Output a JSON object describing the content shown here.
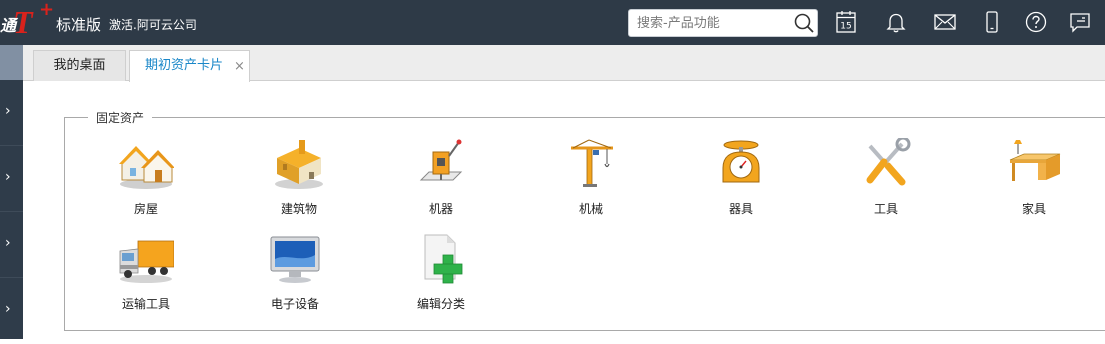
{
  "header": {
    "logo_partial": "通",
    "logo_t": "T",
    "logo_plus": "+",
    "edition": "标准版",
    "activate_text": "激活.阿可云公司",
    "search_placeholder": "搜索-产品功能",
    "calendar_day": "15",
    "icons": [
      "calendar-icon",
      "bell-icon",
      "mail-icon",
      "mobile-icon",
      "help-icon",
      "message-icon"
    ]
  },
  "sidebar": {
    "chevron": "›",
    "items": 4
  },
  "tabs": [
    {
      "label": "我的桌面",
      "active": false
    },
    {
      "label": "期初资产卡片",
      "active": true,
      "close": "×"
    }
  ],
  "group": {
    "legend": "固定资产",
    "assets": [
      {
        "label": "房屋",
        "icon": "houses-icon"
      },
      {
        "label": "建筑物",
        "icon": "building-icon"
      },
      {
        "label": "机器",
        "icon": "machine-icon"
      },
      {
        "label": "机械",
        "icon": "crane-icon"
      },
      {
        "label": "器具",
        "icon": "scale-icon"
      },
      {
        "label": "工具",
        "icon": "tools-icon"
      },
      {
        "label": "家具",
        "icon": "desk-icon"
      },
      {
        "label": "运输工具",
        "icon": "truck-icon"
      },
      {
        "label": "电子设备",
        "icon": "monitor-icon"
      },
      {
        "label": "编辑分类",
        "icon": "add-category-icon"
      }
    ]
  },
  "colors": {
    "topbar": "#2e3a47",
    "brand_red": "#d9221c",
    "active_tab_text": "#1a87c8",
    "sidebar": "#2f3c4a"
  }
}
